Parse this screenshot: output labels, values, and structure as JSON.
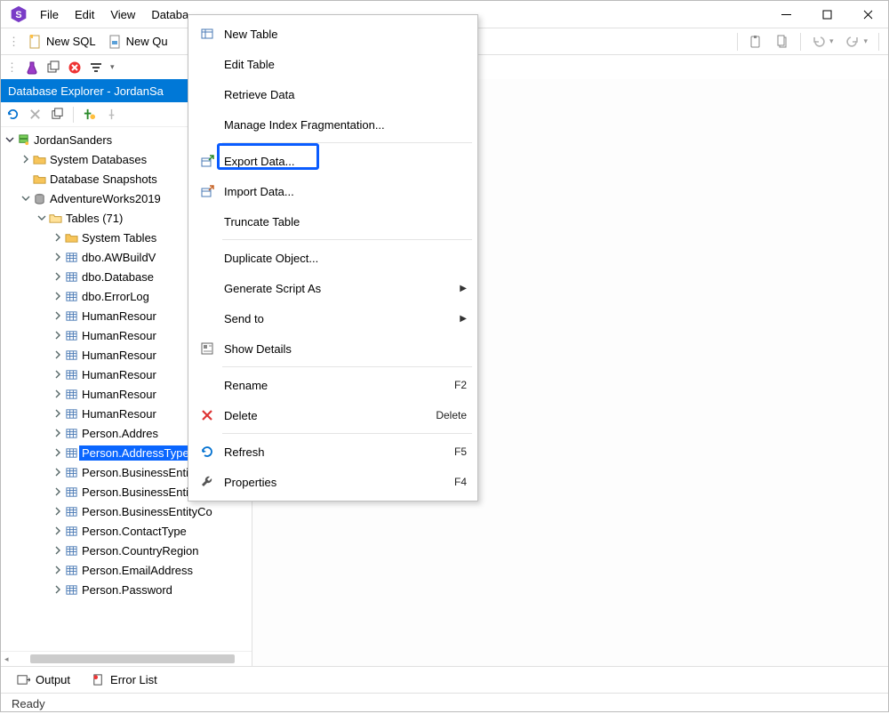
{
  "menu": {
    "file": "File",
    "edit": "Edit",
    "view": "View",
    "database": "Databa"
  },
  "toolbar": {
    "new_sql": "New SQL",
    "new_query": "New Qu"
  },
  "explorer": {
    "title": "Database Explorer - JordanSa",
    "root": "JordanSanders",
    "system_dbs": "System Databases",
    "snapshots": "Database Snapshots",
    "adventure": "AdventureWorks2019",
    "tables": "Tables (71)",
    "system_tables": "System Tables",
    "items": [
      "dbo.AWBuildV",
      "dbo.Database",
      "dbo.ErrorLog",
      "HumanResour",
      "HumanResour",
      "HumanResour",
      "HumanResour",
      "HumanResour",
      "HumanResour",
      "Person.Addres",
      "Person.AddressType",
      "Person.BusinessEntity",
      "Person.BusinessEntityAd",
      "Person.BusinessEntityCo",
      "Person.ContactType",
      "Person.CountryRegion",
      "Person.EmailAddress",
      "Person.Password"
    ],
    "selected_index": 10
  },
  "context_menu": {
    "items": [
      {
        "label": "New Table",
        "icon": "table"
      },
      {
        "label": "Edit Table"
      },
      {
        "label": "Retrieve Data"
      },
      {
        "label": "Manage Index Fragmentation..."
      },
      {
        "sep": true
      },
      {
        "label": "Export Data...",
        "icon": "export",
        "highlight": true
      },
      {
        "label": "Import Data...",
        "icon": "import"
      },
      {
        "label": "Truncate Table"
      },
      {
        "sep": true
      },
      {
        "label": "Duplicate Object..."
      },
      {
        "label": "Generate Script As",
        "submenu": true
      },
      {
        "label": "Send to",
        "submenu": true
      },
      {
        "label": "Show Details",
        "icon": "details"
      },
      {
        "sep": true
      },
      {
        "label": "Rename",
        "shortcut": "F2"
      },
      {
        "label": "Delete",
        "icon": "delete",
        "shortcut": "Delete"
      },
      {
        "sep": true
      },
      {
        "label": "Refresh",
        "icon": "refresh",
        "shortcut": "F5"
      },
      {
        "label": "Properties",
        "icon": "wrench",
        "shortcut": "F4"
      }
    ]
  },
  "bottom": {
    "output": "Output",
    "errors": "Error List"
  },
  "status": {
    "text": "Ready"
  }
}
